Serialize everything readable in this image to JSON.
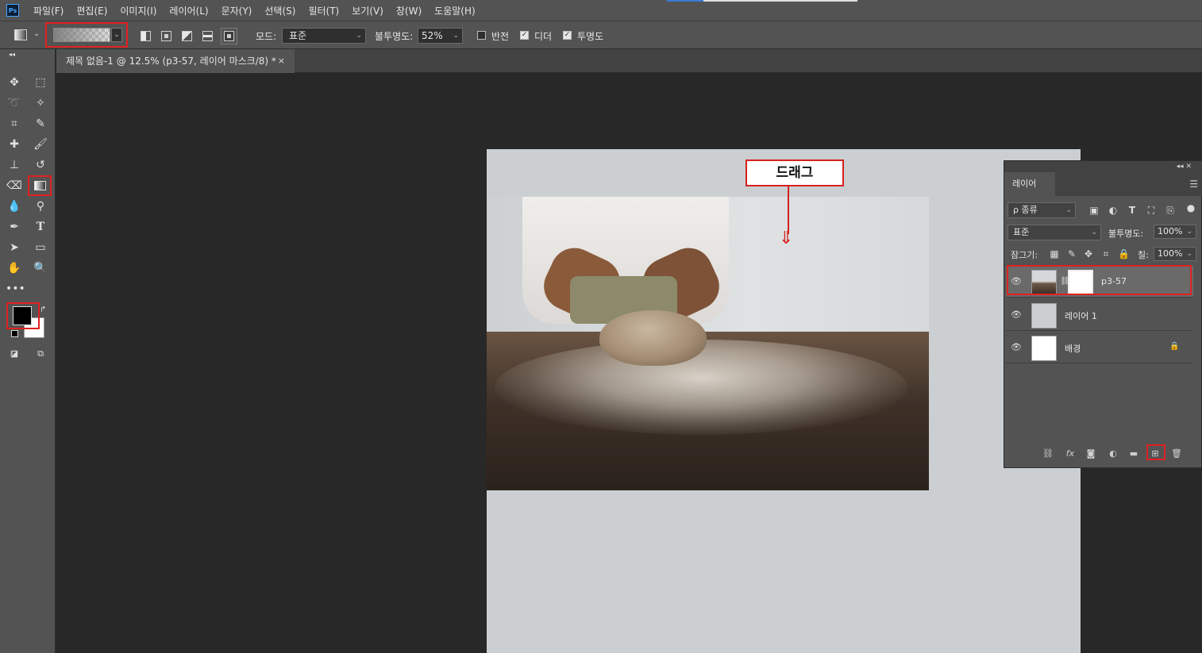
{
  "menubar": {
    "logo": "Ps",
    "items": [
      "파일(F)",
      "편집(E)",
      "이미지(I)",
      "레이어(L)",
      "문자(Y)",
      "선택(S)",
      "필터(T)",
      "보기(V)",
      "창(W)",
      "도움말(H)"
    ]
  },
  "options": {
    "mode_label": "모드:",
    "mode_value": "표준",
    "opacity_label": "불투명도:",
    "opacity_value": "52%",
    "reverse_label": "반전",
    "dither_label": "디더",
    "transparency_label": "투명도",
    "reverse_checked": false,
    "dither_checked": true,
    "transparency_checked": true
  },
  "document_tab": {
    "title": "제목 없음-1 @ 12.5% (p3-57, 레이어 마스크/8) *",
    "close": "×"
  },
  "annotation": {
    "drag_label": "드래그",
    "accent_color": "#d42020"
  },
  "layers_panel": {
    "tab_label": "레이어",
    "filter_label": "ρ 종류",
    "blend_mode": "표준",
    "opacity_label": "불투명도:",
    "opacity_value": "100%",
    "lock_label": "잠그기:",
    "fill_label": "칠:",
    "fill_value": "100%",
    "layers": [
      {
        "name": "p3-57",
        "selected": true
      },
      {
        "name": "레이어 1",
        "selected": false
      },
      {
        "name": "배경",
        "selected": false,
        "locked": true
      }
    ]
  },
  "colors": {
    "foreground": "#000000",
    "background": "#ffffff",
    "highlight": "#e02020"
  }
}
